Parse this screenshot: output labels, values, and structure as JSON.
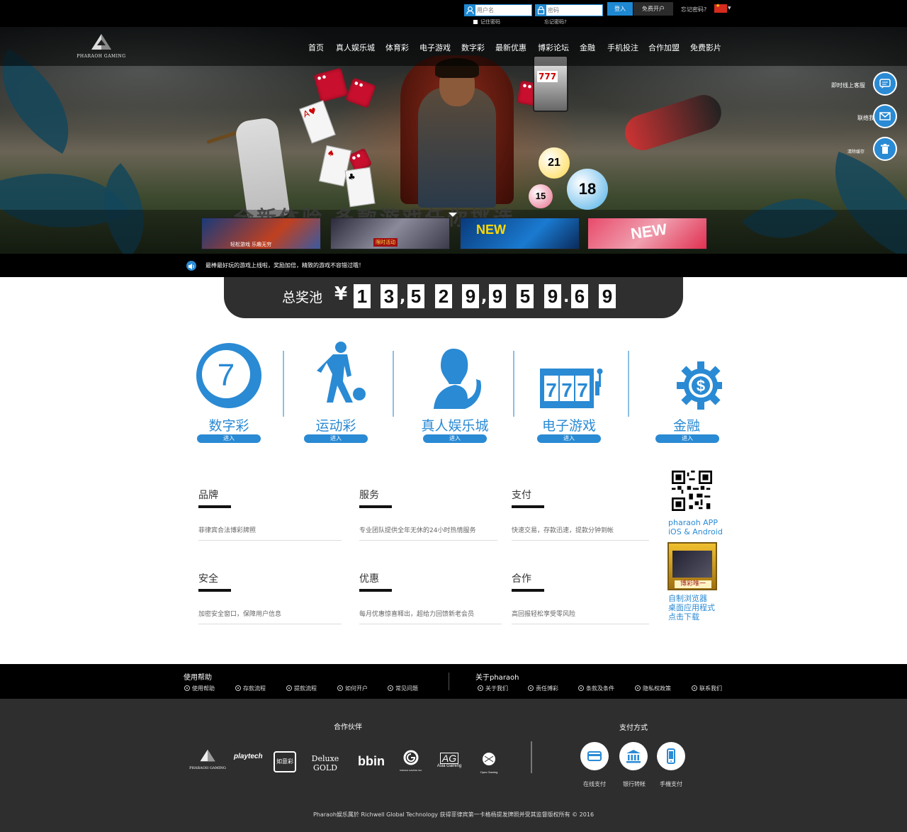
{
  "topbar": {
    "username_placeholder": "用户名",
    "password_placeholder": "密码",
    "remember": "记住密码",
    "forgot_small": "忘记密码?",
    "login": "登入",
    "register": "免费开户",
    "forgot": "忘记密码?"
  },
  "brand": {
    "name": "PHARAOH GAMING"
  },
  "nav": [
    "首页",
    "真人娱乐城",
    "体育彩",
    "电子游戏",
    "数字彩",
    "最新优惠",
    "博彩论坛",
    "金融",
    "手机投注",
    "合作加盟",
    "免费影片"
  ],
  "hero": {
    "banner_text": "全新体验 多款游戏任你挑选",
    "promos": [
      {
        "text": "轻松游戏 乐趣无穷"
      },
      {
        "text": "限时活动"
      },
      {
        "text": "NEW"
      },
      {
        "text": "NEW"
      }
    ],
    "balls": [
      "21",
      "18",
      "15"
    ]
  },
  "side": {
    "service": "即时线上客服",
    "contact": "联络我",
    "clear": "清除缓存"
  },
  "marquee": {
    "text": "最棒最好玩的游戏上线啦，奖励加倍，精致的游戏不容错过哦！"
  },
  "jackpot": {
    "label": "总奖池",
    "currency": "¥",
    "digits": [
      "1",
      "3",
      "5",
      "2",
      "9",
      "9",
      "5",
      "9",
      "6",
      "9"
    ],
    "separators": [
      ",",
      ",",
      "."
    ]
  },
  "categories": [
    {
      "title": "数字彩",
      "enter": "进入",
      "ball_number": "7"
    },
    {
      "title": "运动彩",
      "enter": "进入"
    },
    {
      "title": "真人娱乐城",
      "enter": "进入"
    },
    {
      "title": "电子游戏",
      "enter": "进入",
      "slot_text": "777"
    },
    {
      "title": "金融",
      "enter": "进入",
      "symbol": "$"
    }
  ],
  "features": [
    {
      "title": "品牌",
      "desc": "菲律宾合法博彩牌照"
    },
    {
      "title": "服务",
      "desc": "专业团队提供全年无休的24小时热情服务"
    },
    {
      "title": "支付",
      "desc": "快速交易，存款迅速，提款分钟到帐"
    },
    {
      "title": "安全",
      "desc": "加密安全窗口，保障用户信息"
    },
    {
      "title": "优惠",
      "desc": "每月优惠惊喜释出，超给力回馈新老会员"
    },
    {
      "title": "合作",
      "desc": "高回报轻松享受零风险"
    }
  ],
  "app": {
    "line1": "pharaoh APP",
    "line2": "iOS & Android",
    "browser_tag": "博彩唯一",
    "browser1": "自制浏览器",
    "browser2": "桌面应用程式",
    "browser3": "点击下载"
  },
  "help": {
    "title": "使用帮助",
    "items": [
      "使用帮助",
      "存款流程",
      "提款流程",
      "如何开户",
      "常见问题"
    ],
    "about_title": "关于pharaoh",
    "about_items": [
      "关于我们",
      "责任博彩",
      "条款及条件",
      "隐私权政策",
      "联系我们"
    ]
  },
  "partners": {
    "title": "合作伙伴",
    "logos": [
      "PHARAOH GAMING",
      "playtech",
      "如意彩",
      "Deluxe GOLD",
      "bbin",
      "SINGSHI GAMING INC.",
      "Asia Gaming",
      "Opus Gaming"
    ],
    "payment_title": "支付方式",
    "payments": [
      "在线支付",
      "银行转帐",
      "手機支付"
    ],
    "copyright": "Pharaoh娱乐属於 Richwell Global Technology 获得菲律宾第一卡格杨提发牌照并受其监督版权所有 © 2016"
  },
  "colors": {
    "accent": "#2a8ad4",
    "dark": "#2e2e2e",
    "black": "#000000"
  }
}
